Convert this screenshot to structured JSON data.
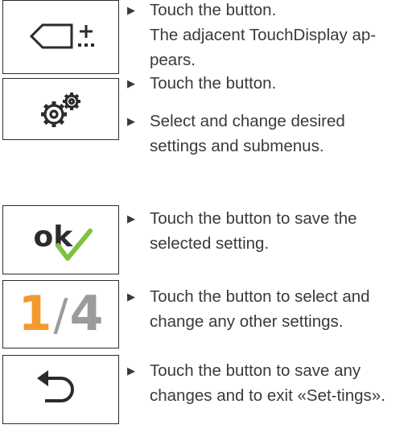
{
  "steps": [
    {
      "icon": "add-display-icon",
      "instruction": "Touch the button.",
      "result": "The adjacent TouchDisplay ap-pears."
    },
    {
      "icon": "settings-gears-icon",
      "instruction": "Touch the button."
    },
    {
      "instruction": "Select and change desired settings and submenus."
    },
    {
      "icon": "ok-check-icon",
      "ok_text": "ok",
      "instruction": "Touch the button to save the selected setting."
    },
    {
      "icon": "page-indicator-icon",
      "page_current": "1",
      "page_sep": "/",
      "page_total": "4",
      "instruction": "Touch the button to select and change any other settings."
    },
    {
      "icon": "back-arrow-icon",
      "instruction": "Touch the button to save any changes and to exit «Set-tings»."
    }
  ],
  "colors": {
    "accent_orange": "#f39a2e",
    "check_green": "#7cc242",
    "text": "#3a3a3a",
    "page_grey": "#9b9b9b"
  }
}
